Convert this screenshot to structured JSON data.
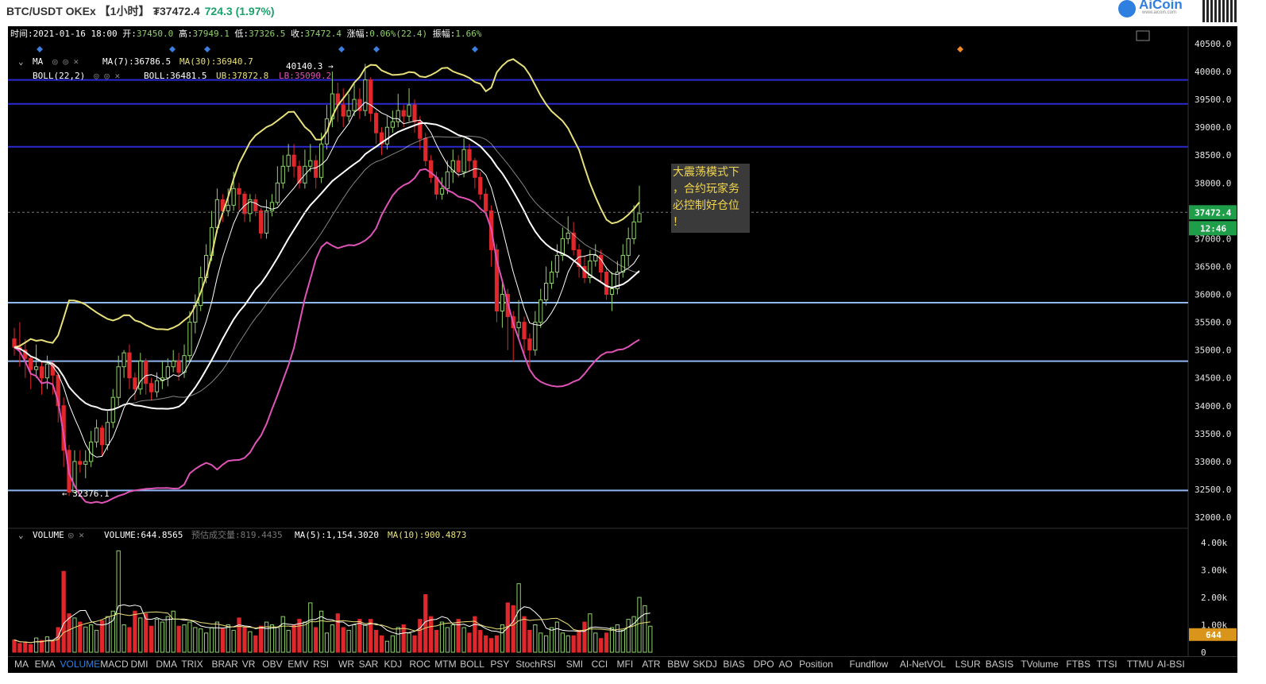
{
  "header": {
    "pair": "BTC/USDT OKEx 【1小时】",
    "price": "₮37472.4",
    "change": "724.3 (1.97%)",
    "logo_text": "AiCoin",
    "logo_url": "www.aicoin.com"
  },
  "info_bar": {
    "time_label": "时间:",
    "time": "2021-01-16 18:00",
    "open_label": "开:",
    "open": "37450.0",
    "high_label": "高:",
    "high": "37949.1",
    "low_label": "低:",
    "low": "37326.5",
    "close_label": "收:",
    "close": "37472.4",
    "change_label": "涨幅:",
    "change": "0.06%(22.4)",
    "amplitude_label": "振幅:",
    "amplitude": "1.66%"
  },
  "indicators": {
    "ma_name": "MA",
    "ma7": "MA(7):36786.5",
    "ma30": "MA(30):36940.7",
    "boll_name": "BOLL(22,2)",
    "boll": "BOLL:36481.5",
    "ub": "UB:37872.8",
    "lb": "LB:35090.2"
  },
  "annotations": {
    "high_marker": "40140.3 →",
    "low_marker": "← 32376.1",
    "note_lines": [
      "大震荡模式下",
      "，合约玩家务",
      "必控制好仓位",
      "！"
    ]
  },
  "price_axis": {
    "ticks": [
      "40500.0",
      "40000.0",
      "39500.0",
      "39000.0",
      "38500.0",
      "38000.0",
      "37000.0",
      "36500.0",
      "36000.0",
      "35500.0",
      "35000.0",
      "34500.0",
      "34000.0",
      "33500.0",
      "33000.0",
      "32500.0",
      "32000.0"
    ],
    "current_price": "37472.4",
    "countdown": "12:46"
  },
  "volume_panel": {
    "name": "VOLUME",
    "volume": "VOLUME:644.8565",
    "estimated": "预估成交量:819.4435",
    "ma5": "MA(5):1,154.3020",
    "ma10": "MA(10):900.4873",
    "ticks": [
      "4.00k",
      "3.00k",
      "2.00k",
      "1.00k",
      "0"
    ],
    "current": "644"
  },
  "tabs": [
    "MA",
    "EMA",
    "VOLUME",
    "MACD",
    "DMI",
    "DMA",
    "TRIX",
    "BRAR",
    "VR",
    "OBV",
    "EMV",
    "RSI",
    "WR",
    "SAR",
    "KDJ",
    "ROC",
    "MTM",
    "BOLL",
    "PSY",
    "StochRSI",
    "SMI",
    "CCI",
    "MFI",
    "ATR",
    "BBW",
    "SKDJ",
    "BIAS",
    "DPO",
    "AO",
    "Position",
    "Fundflow",
    "AI-NetVOL",
    "LSUR",
    "BASIS",
    "TVolume",
    "FTBS",
    "TTSI",
    "TTMU",
    "AI-BSI"
  ],
  "active_tab": "VOLUME",
  "colors": {
    "up": "#8fd16a",
    "down": "#e0272b",
    "boll_ub": "#e8e07a",
    "boll_lb": "#e054b8",
    "ma7": "#ffffff",
    "ma30": "#dddddd",
    "hline_dark": "#2a2ad0",
    "hline_light": "#8fb7f0",
    "price_badge": "#1f9e4a",
    "vol_badge": "#d9941a"
  },
  "chart_data": {
    "type": "candlestick",
    "price_range": [
      31800,
      40700
    ],
    "levels": [
      39850,
      39420,
      38650,
      35850,
      34800,
      32480
    ],
    "candles": [
      [
        35200,
        35050,
        35400,
        34900
      ],
      [
        35050,
        35000,
        35500,
        34700
      ],
      [
        35000,
        34850,
        35200,
        34500
      ],
      [
        34850,
        34650,
        34900,
        34300
      ],
      [
        34650,
        34700,
        35100,
        34500
      ],
      [
        34700,
        34500,
        34800,
        34200
      ],
      [
        34500,
        34750,
        34900,
        34300
      ],
      [
        34750,
        34550,
        34800,
        34200
      ],
      [
        34550,
        34000,
        34600,
        33700
      ],
      [
        34000,
        33200,
        34150,
        32900
      ],
      [
        33200,
        32450,
        33300,
        32380
      ],
      [
        32450,
        33000,
        33200,
        32450
      ],
      [
        33000,
        32950,
        33200,
        32800
      ],
      [
        32950,
        33000,
        33200,
        32700
      ],
      [
        33000,
        33350,
        33550,
        32900
      ],
      [
        33350,
        33600,
        33750,
        33250
      ],
      [
        33600,
        33300,
        33650,
        33100
      ],
      [
        33300,
        33700,
        33900,
        33200
      ],
      [
        33700,
        34150,
        34300,
        33600
      ],
      [
        34150,
        34700,
        34900,
        34000
      ],
      [
        34700,
        34950,
        35000,
        34500
      ],
      [
        34950,
        34500,
        35100,
        34300
      ],
      [
        34500,
        34300,
        34600,
        34100
      ],
      [
        34300,
        34800,
        34950,
        34200
      ],
      [
        34800,
        34400,
        34850,
        34200
      ],
      [
        34400,
        34250,
        34500,
        34100
      ],
      [
        34250,
        34450,
        34600,
        34150
      ],
      [
        34450,
        34500,
        34800,
        34300
      ],
      [
        34500,
        34700,
        34850,
        34350
      ],
      [
        34700,
        34800,
        35000,
        34600
      ],
      [
        34800,
        34600,
        34950,
        34450
      ],
      [
        34600,
        34900,
        35100,
        34500
      ],
      [
        34900,
        35500,
        35700,
        34800
      ],
      [
        35500,
        35800,
        36000,
        35300
      ],
      [
        35800,
        36300,
        36500,
        35700
      ],
      [
        36300,
        36700,
        36900,
        36200
      ],
      [
        36700,
        37200,
        37500,
        36600
      ],
      [
        37200,
        37700,
        37900,
        37100
      ],
      [
        37700,
        37500,
        37800,
        37300
      ],
      [
        37500,
        37600,
        37900,
        37400
      ],
      [
        37600,
        37900,
        38200,
        37500
      ],
      [
        37900,
        37800,
        38000,
        37500
      ],
      [
        37800,
        37450,
        37850,
        37300
      ],
      [
        37450,
        37700,
        37800,
        37300
      ],
      [
        37700,
        37500,
        37800,
        37400
      ],
      [
        37500,
        37100,
        37550,
        37000
      ],
      [
        37100,
        37500,
        37700,
        37000
      ],
      [
        37500,
        37650,
        37800,
        37400
      ],
      [
        37650,
        38000,
        38300,
        37600
      ],
      [
        38000,
        38300,
        38500,
        37900
      ],
      [
        38300,
        38500,
        38700,
        38200
      ],
      [
        38500,
        38300,
        38700,
        38100
      ],
      [
        38300,
        38000,
        38400,
        37900
      ],
      [
        38000,
        38300,
        38600,
        37900
      ],
      [
        38300,
        38400,
        38700,
        38200
      ],
      [
        38400,
        38100,
        38500,
        37900
      ],
      [
        38100,
        38700,
        38900,
        38000
      ],
      [
        38700,
        39150,
        39400,
        38600
      ],
      [
        39150,
        39600,
        40000,
        39000
      ],
      [
        39600,
        39400,
        39800,
        39100
      ],
      [
        39400,
        39200,
        39700,
        39000
      ],
      [
        39200,
        39300,
        39600,
        39100
      ],
      [
        39300,
        39500,
        39800,
        39200
      ],
      [
        39500,
        39300,
        39700,
        39150
      ],
      [
        39300,
        39850,
        40140,
        39200
      ],
      [
        39850,
        39250,
        39900,
        39100
      ],
      [
        39250,
        38900,
        39300,
        38700
      ],
      [
        38900,
        38700,
        39000,
        38500
      ],
      [
        38700,
        39000,
        39200,
        38600
      ],
      [
        39000,
        39100,
        39300,
        38900
      ],
      [
        39100,
        39300,
        39600,
        39000
      ],
      [
        39300,
        39200,
        39400,
        39000
      ],
      [
        39200,
        39400,
        39700,
        39100
      ],
      [
        39400,
        39100,
        39500,
        38900
      ],
      [
        39100,
        38800,
        39200,
        38600
      ],
      [
        38800,
        38400,
        38900,
        38300
      ],
      [
        38400,
        38100,
        38500,
        38000
      ],
      [
        38100,
        37800,
        38200,
        37700
      ],
      [
        37800,
        37900,
        38100,
        37700
      ],
      [
        37900,
        38200,
        38400,
        37800
      ],
      [
        38200,
        38400,
        38600,
        38000
      ],
      [
        38400,
        38200,
        38500,
        38100
      ],
      [
        38200,
        38600,
        38800,
        38100
      ],
      [
        38600,
        38400,
        38700,
        38200
      ],
      [
        38400,
        38100,
        38450,
        37900
      ],
      [
        38100,
        37800,
        38200,
        37700
      ],
      [
        37800,
        37500,
        37900,
        37400
      ],
      [
        37500,
        36800,
        37600,
        36500
      ],
      [
        36800,
        35700,
        36900,
        35500
      ],
      [
        35700,
        36000,
        36200,
        35400
      ],
      [
        36000,
        35600,
        36100,
        35000
      ],
      [
        35600,
        35400,
        35700,
        34800
      ],
      [
        35400,
        35500,
        35900,
        35200
      ],
      [
        35500,
        35200,
        35600,
        34900
      ],
      [
        35200,
        35000,
        35300,
        34700
      ],
      [
        35000,
        35500,
        35700,
        34900
      ],
      [
        35500,
        35900,
        36100,
        35400
      ],
      [
        35900,
        36200,
        36500,
        35800
      ],
      [
        36200,
        36400,
        36600,
        36100
      ],
      [
        36400,
        36700,
        36900,
        36300
      ],
      [
        36700,
        37000,
        37200,
        36600
      ],
      [
        37000,
        37100,
        37400,
        36900
      ],
      [
        37100,
        36800,
        37300,
        36700
      ],
      [
        36800,
        36500,
        36900,
        36300
      ],
      [
        36500,
        36300,
        36700,
        36200
      ],
      [
        36300,
        36600,
        36800,
        36200
      ],
      [
        36600,
        36700,
        36900,
        36500
      ],
      [
        36700,
        36400,
        36800,
        36200
      ],
      [
        36400,
        36000,
        36500,
        35900
      ],
      [
        36000,
        36100,
        36400,
        35700
      ],
      [
        36100,
        36400,
        36600,
        36000
      ],
      [
        36400,
        36700,
        36900,
        36300
      ],
      [
        36700,
        37000,
        37200,
        36500
      ],
      [
        37000,
        37300,
        37600,
        36900
      ],
      [
        37300,
        37450,
        37950,
        37320
      ]
    ],
    "volumes": [
      450,
      320,
      350,
      280,
      520,
      430,
      560,
      400,
      900,
      2950,
      1400,
      1250,
      1100,
      920,
      1000,
      800,
      1150,
      1300,
      1500,
      3700,
      1000,
      900,
      1500,
      1250,
      1400,
      950,
      1200,
      1100,
      1300,
      1500,
      950,
      1000,
      1100,
      900,
      850,
      700,
      900,
      1100,
      850,
      1000,
      800,
      1250,
      900,
      750,
      600,
      950,
      1100,
      1000,
      900,
      1300,
      800,
      1000,
      1200,
      1100,
      1800,
      900,
      1500,
      700,
      1000,
      1400,
      900,
      800,
      1000,
      1200,
      1000,
      1200,
      800,
      600,
      400,
      600,
      900,
      1000,
      700,
      600,
      1200,
      2100,
      1300,
      800,
      1100,
      900,
      1000,
      1200,
      900,
      700,
      1300,
      800,
      600,
      500,
      600,
      1000,
      1800,
      1700,
      2500,
      1300,
      800,
      1000,
      700,
      600,
      900,
      1100,
      700,
      600,
      600,
      800,
      1100,
      1400,
      700,
      500,
      700,
      900,
      1000,
      800,
      1200,
      1300,
      2000,
      1700,
      950
    ]
  }
}
